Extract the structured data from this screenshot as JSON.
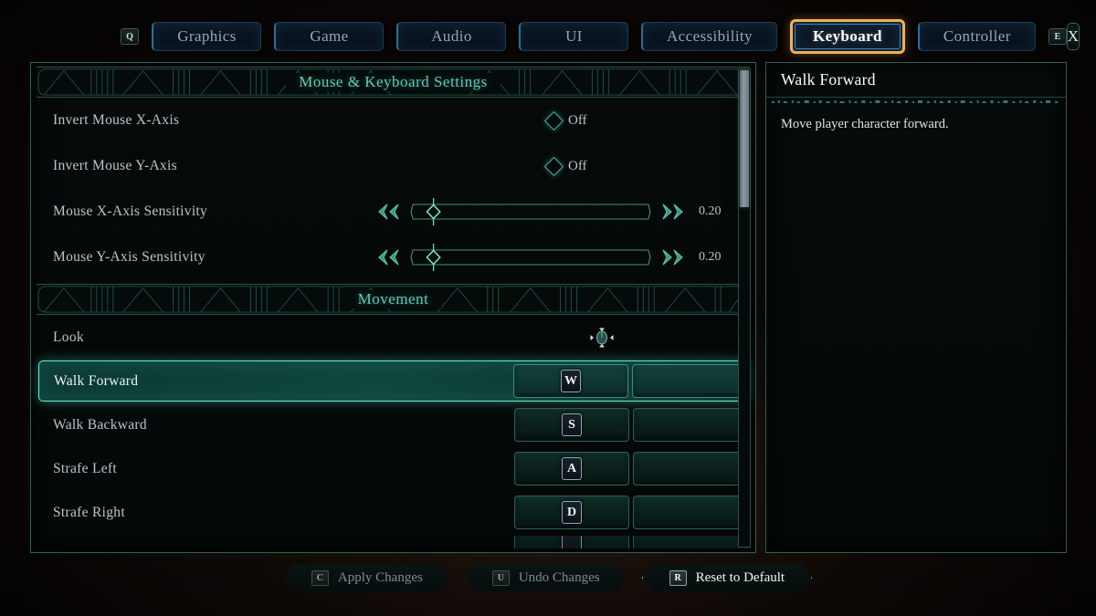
{
  "topbar": {
    "left_hint": "Q",
    "right_hint": "E",
    "close_label": "X",
    "tabs": [
      {
        "label": "Graphics",
        "selected": false
      },
      {
        "label": "Game",
        "selected": false
      },
      {
        "label": "Audio",
        "selected": false
      },
      {
        "label": "UI",
        "selected": false
      },
      {
        "label": "Accessibility",
        "selected": false
      },
      {
        "label": "Keyboard",
        "selected": true
      },
      {
        "label": "Controller",
        "selected": false
      }
    ]
  },
  "settings_panel": {
    "section1_title": "Mouse & Keyboard Settings",
    "section2_title": "Movement",
    "options": [
      {
        "label": "Invert Mouse X-Axis",
        "type": "toggle",
        "value": "Off"
      },
      {
        "label": "Invert Mouse Y-Axis",
        "type": "toggle",
        "value": "Off"
      },
      {
        "label": "Mouse X-Axis Sensitivity",
        "type": "slider",
        "value": "0.20",
        "fill": 0.11
      },
      {
        "label": "Mouse Y-Axis Sensitivity",
        "type": "slider",
        "value": "0.20",
        "fill": 0.11
      }
    ],
    "look_row": {
      "label": "Look",
      "icon": "mouse-look-icon"
    },
    "bindings": [
      {
        "label": "Walk Forward",
        "primary": "W",
        "secondary": "",
        "selected": true
      },
      {
        "label": "Walk Backward",
        "primary": "S",
        "secondary": "",
        "selected": false
      },
      {
        "label": "Strafe Left",
        "primary": "A",
        "secondary": "",
        "selected": false
      },
      {
        "label": "Strafe Right",
        "primary": "D",
        "secondary": "",
        "selected": false
      },
      {
        "label": "",
        "primary": "",
        "secondary": "",
        "selected": false
      }
    ]
  },
  "info_panel": {
    "title": "Walk Forward",
    "description": "Move player character forward."
  },
  "actionbar": {
    "buttons": [
      {
        "hint": "C",
        "label": "Apply Changes",
        "highlight": false
      },
      {
        "hint": "U",
        "label": "Undo Changes",
        "highlight": false
      },
      {
        "hint": "R",
        "label": "Reset to Default",
        "highlight": true
      }
    ]
  },
  "colors": {
    "accent_teal": "#46b9a6",
    "accent_selected": "#5cf0d4",
    "tab_selected_border": "#f0ae54",
    "panel_border": "#2d5f55",
    "text_primary": "#b9c6cf"
  }
}
